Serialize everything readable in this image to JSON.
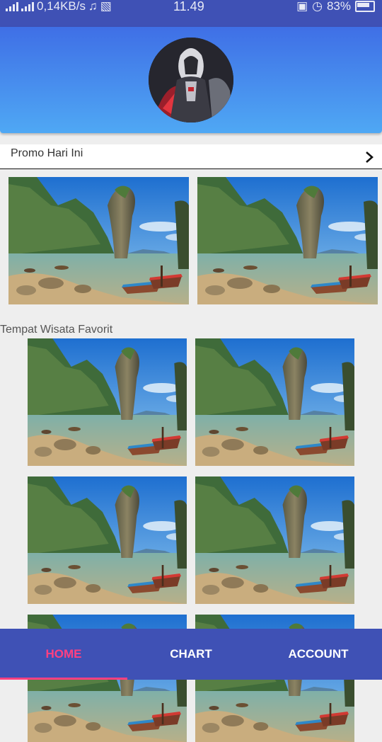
{
  "status_bar": {
    "network_speed": "0,14KB/s",
    "time": "11.49",
    "battery": "83%"
  },
  "header": {
    "avatar_icon": "assassin-avatar-icon",
    "gradient_top": "#3f6fe6",
    "gradient_bottom": "#4fa8f4"
  },
  "promo": {
    "title": "Promo Hari Ini",
    "arrow_icon": "chevron-right-icon",
    "images": [
      "island-scene-image",
      "island-scene-image"
    ]
  },
  "favorites": {
    "title": "Tempat Wisata Favorit",
    "images": [
      "island-scene-image",
      "island-scene-image",
      "island-scene-image",
      "island-scene-image",
      "island-scene-image",
      "island-scene-image"
    ]
  },
  "bottom_nav": {
    "items": [
      {
        "label": "HOME",
        "active": true
      },
      {
        "label": "CHART",
        "active": false
      },
      {
        "label": "ACCOUNT",
        "active": false
      }
    ],
    "active_color": "#ff4081",
    "background": "#3f51b5"
  }
}
